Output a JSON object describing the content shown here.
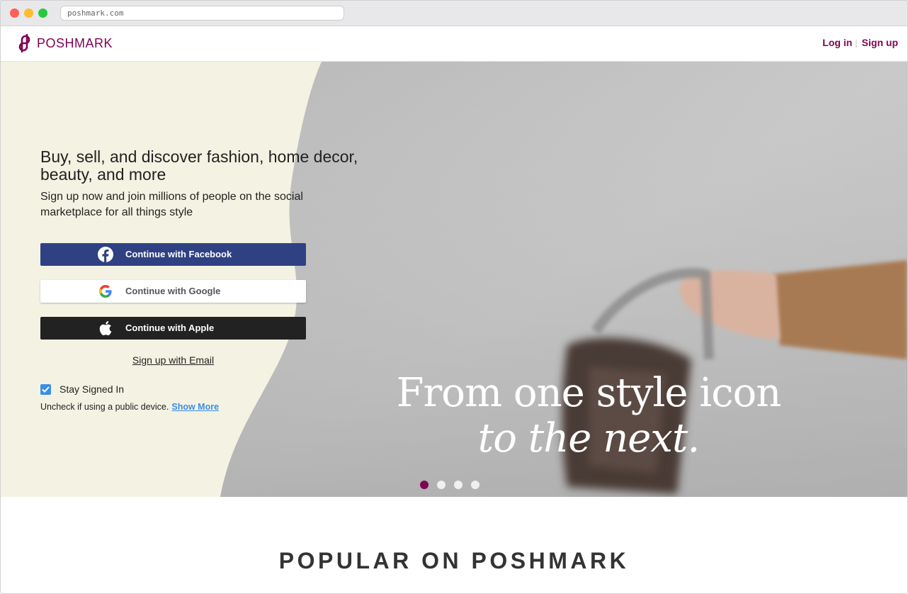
{
  "browser": {
    "url": "poshmark.com"
  },
  "header": {
    "brand": "POSHMARK",
    "login_label": "Log in",
    "separator": "|",
    "signup_label": "Sign up"
  },
  "hero": {
    "headline": "Buy, sell, and discover fashion, home decor, beauty, and more",
    "subhead": "Sign up now and join millions of people on the social marketplace for all things style",
    "facebook_label": "Continue with Facebook",
    "google_label": "Continue with Google",
    "apple_label": "Continue with Apple",
    "email_label": "Sign up with Email",
    "stay_signed_in_label": "Stay Signed In",
    "stay_signed_in_checked": true,
    "public_device_text": "Uncheck if using a public device.",
    "show_more_label": "Show More",
    "tagline_line1": "From one style icon",
    "tagline_line2": "to the next.",
    "carousel": {
      "count": 4,
      "active_index": 0
    }
  },
  "section": {
    "popular_title": "POPULAR ON POSHMARK"
  },
  "colors": {
    "brand": "#7f0353",
    "facebook": "#2f4183",
    "apple": "#222222",
    "link_blue": "#3a8ee6",
    "hero_cream": "#f4f2e2"
  },
  "icons": {
    "logo": "poshmark-logo-icon",
    "facebook": "facebook-icon",
    "google": "google-icon",
    "apple": "apple-icon",
    "check": "checkmark-icon"
  }
}
